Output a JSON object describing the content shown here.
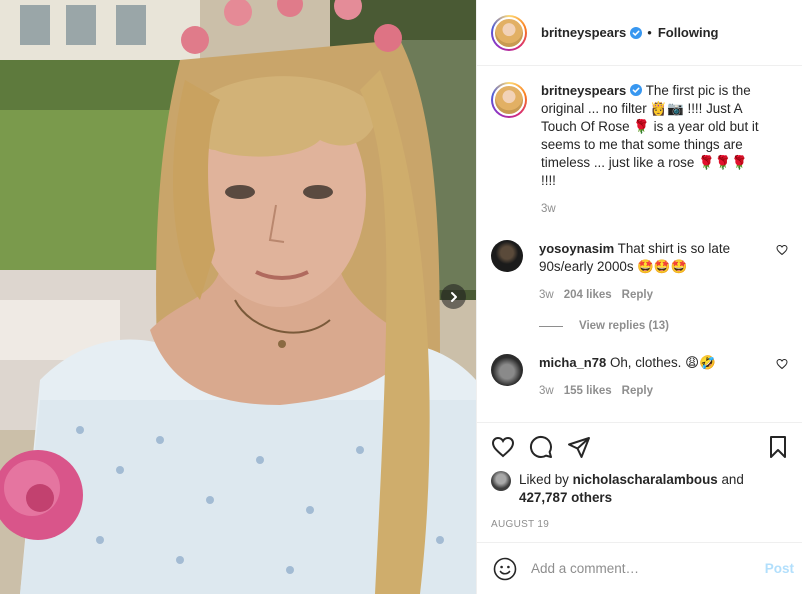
{
  "post": {
    "username": "britneyspears",
    "follow_status": "Following",
    "separator": "•"
  },
  "caption": {
    "username": "britneyspears",
    "text": "The first pic is the original ... no filter 👸📷 !!!! Just A Touch Of Rose 🌹 is a year old but it seems to me that some things are timeless ... just like a rose 🌹🌹🌹 !!!!",
    "time": "3w"
  },
  "comments": [
    {
      "username": "yosoynasim",
      "text": "That shirt is so late 90s/early 2000s 🤩🤩🤩",
      "time": "3w",
      "likes": "204 likes",
      "reply": "Reply",
      "view_replies": "View replies (13)"
    },
    {
      "username": "micha_n78",
      "text": "Oh, clothes. 😩🤣",
      "time": "3w",
      "likes": "155 likes",
      "reply": "Reply"
    }
  ],
  "likes": {
    "prefix": "Liked by",
    "user": "nicholascharalambous",
    "and": "and",
    "others": "427,787 others"
  },
  "date": "AUGUST 19",
  "add_comment": {
    "placeholder": "Add a comment…",
    "post_label": "Post"
  },
  "icons": {
    "like": "heart-icon",
    "comment": "comment-icon",
    "share": "share-icon",
    "save": "bookmark-icon",
    "emoji": "emoji-icon",
    "next": "chevron-right-icon",
    "verified": "verified-badge-icon"
  },
  "colors": {
    "verified": "#3897f0",
    "muted": "#8e8e8e",
    "post_button": "#b2dffc",
    "text": "#262626"
  }
}
